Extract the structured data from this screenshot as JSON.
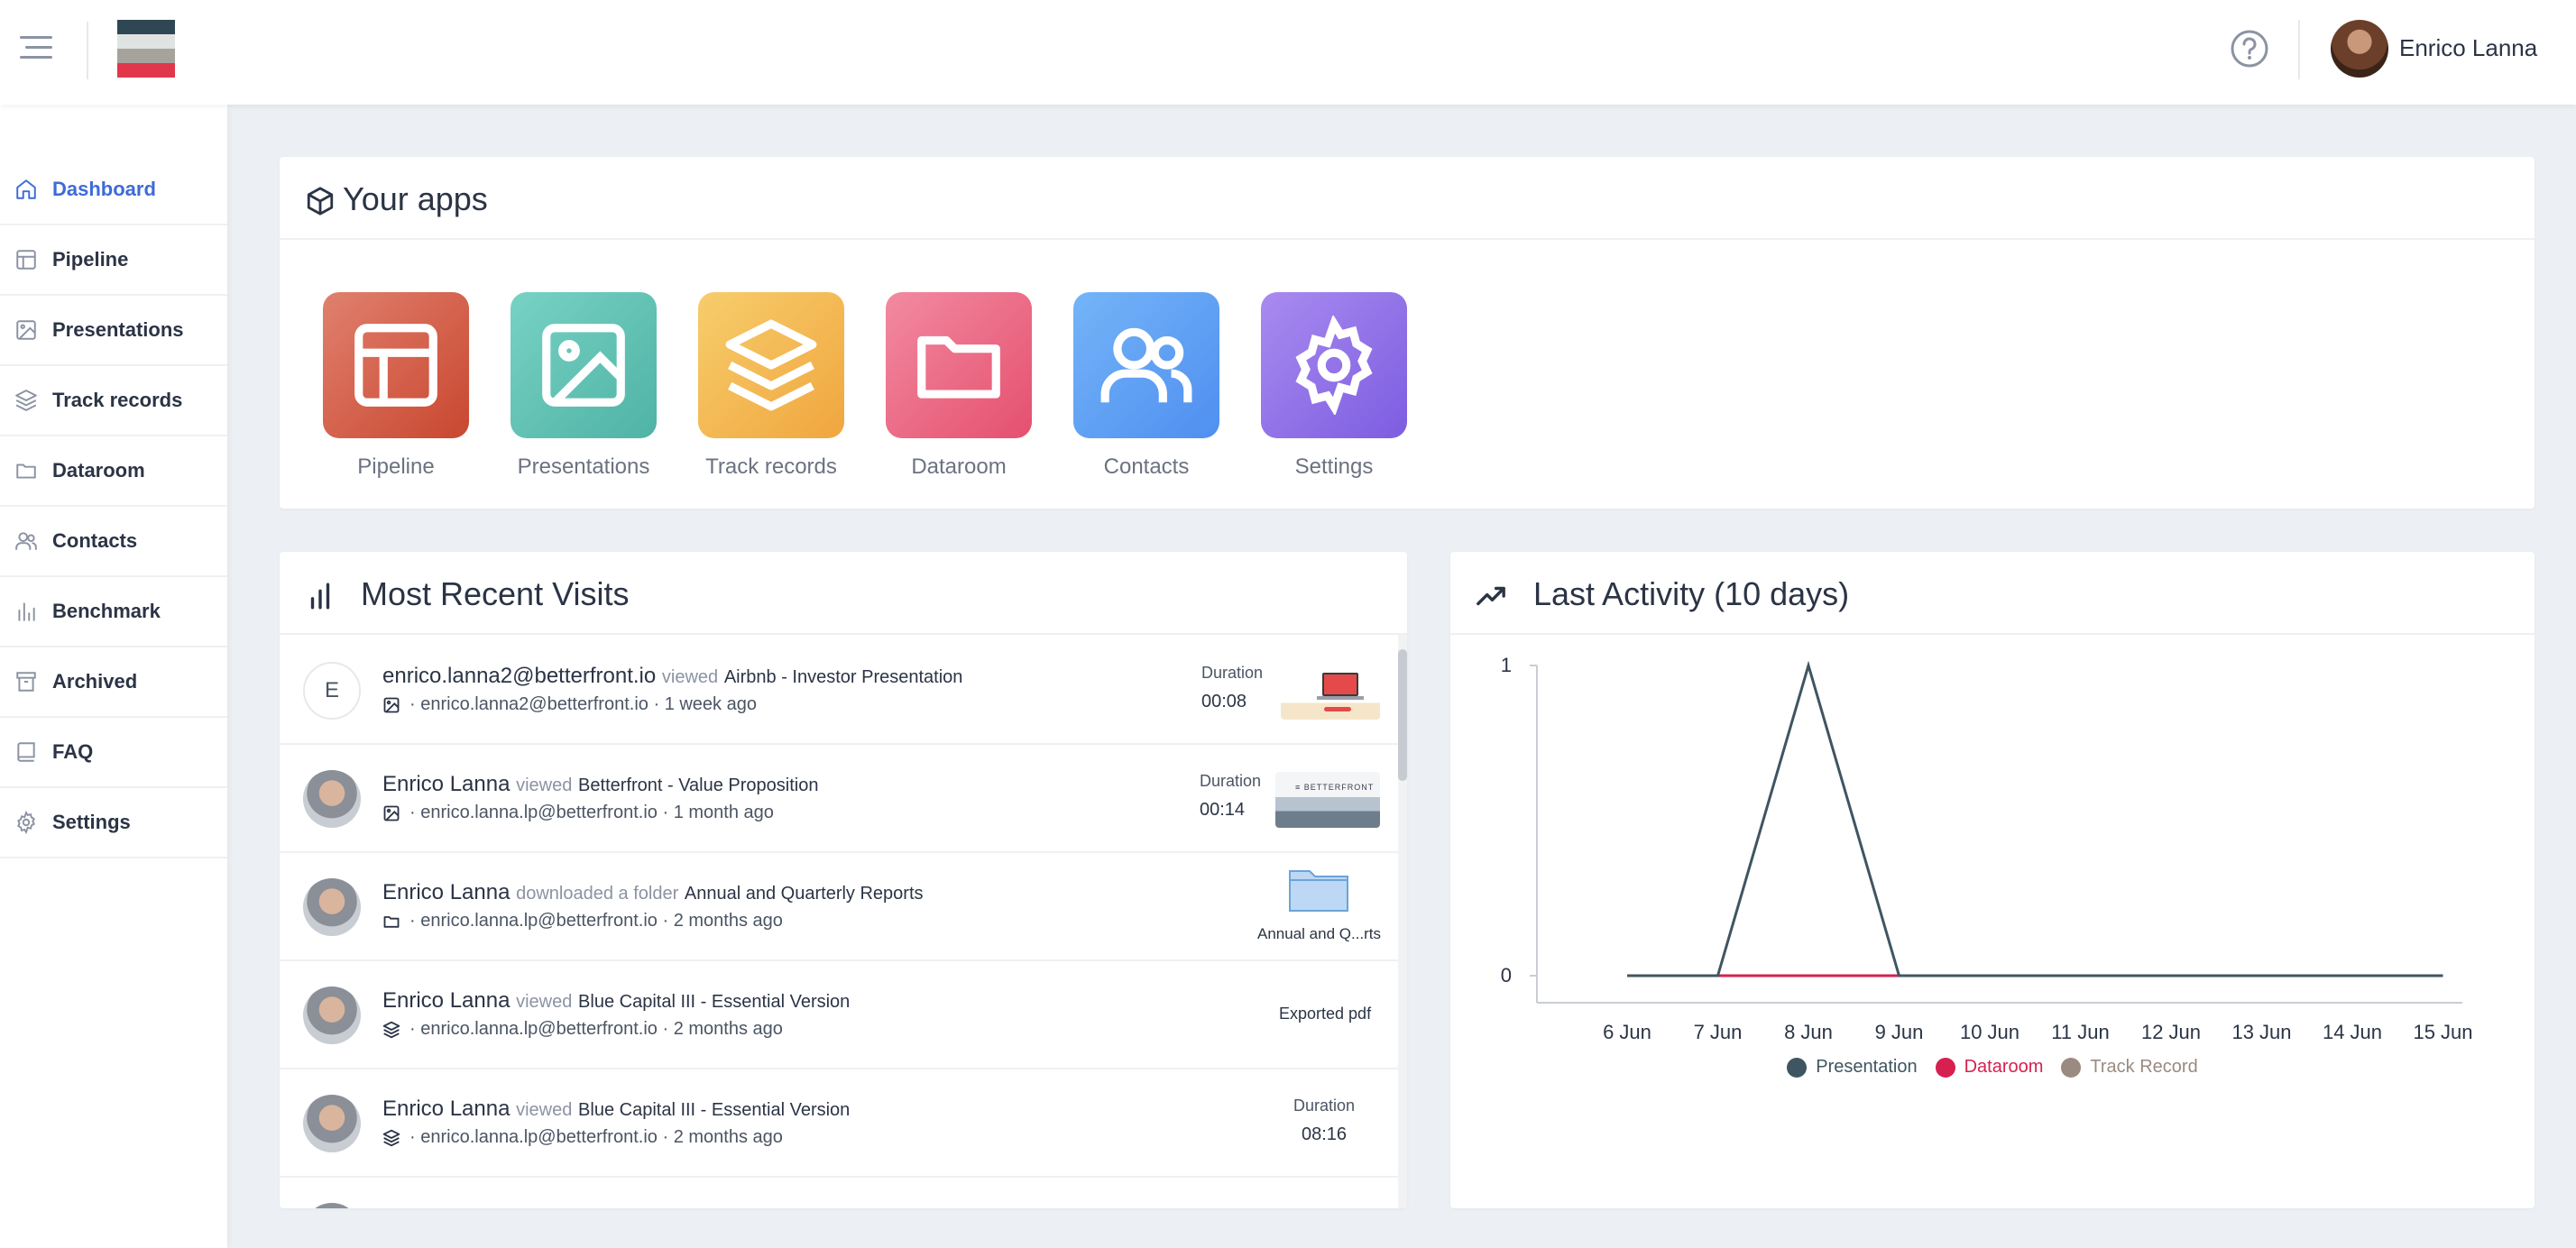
{
  "header": {
    "user_name": "Enrico Lanna"
  },
  "sidebar": {
    "items": [
      {
        "label": "Dashboard",
        "icon": "home-icon",
        "active": true
      },
      {
        "label": "Pipeline",
        "icon": "layout-icon"
      },
      {
        "label": "Presentations",
        "icon": "image-icon"
      },
      {
        "label": "Track records",
        "icon": "layers-icon"
      },
      {
        "label": "Dataroom",
        "icon": "folder-icon"
      },
      {
        "label": "Contacts",
        "icon": "users-icon"
      },
      {
        "label": "Benchmark",
        "icon": "bar-chart-icon"
      },
      {
        "label": "Archived",
        "icon": "archive-icon"
      },
      {
        "label": "FAQ",
        "icon": "book-icon"
      },
      {
        "label": "Settings",
        "icon": "gear-icon"
      }
    ]
  },
  "apps": {
    "title": "Your apps",
    "items": [
      {
        "label": "Pipeline",
        "icon": "layout-icon",
        "color_from": "#e0806e",
        "color_to": "#c9472f"
      },
      {
        "label": "Presentations",
        "icon": "image-icon",
        "color_from": "#77d2c4",
        "color_to": "#4fb3a5"
      },
      {
        "label": "Track records",
        "icon": "layers-icon",
        "color_from": "#f7cd6c",
        "color_to": "#f0a63e"
      },
      {
        "label": "Dataroom",
        "icon": "folder-icon",
        "color_from": "#f28aa0",
        "color_to": "#e5506f"
      },
      {
        "label": "Contacts",
        "icon": "users-icon",
        "color_from": "#74b4f8",
        "color_to": "#4f8ff0"
      },
      {
        "label": "Settings",
        "icon": "gear-icon",
        "color_from": "#a98bf0",
        "color_to": "#7d5de0"
      }
    ]
  },
  "visits": {
    "title": "Most Recent Visits",
    "rows": [
      {
        "avatar_letter": "E",
        "name": "enrico.lanna2@betterfront.io",
        "verb": "viewed",
        "object": "Airbnb - Investor Presentation",
        "email": "enrico.lanna2@betterfront.io",
        "ago": "1 week ago",
        "type_icon": "image-icon",
        "meta_label": "Duration",
        "meta_value": "00:08",
        "thumb": "presentation"
      },
      {
        "avatar_letter": "",
        "name": "Enrico Lanna",
        "verb": "viewed",
        "object": "Betterfront - Value Proposition",
        "email": "enrico.lanna.lp@betterfront.io",
        "ago": "1 month ago",
        "type_icon": "image-icon",
        "meta_label": "Duration",
        "meta_value": "00:14",
        "thumb": "betterfront",
        "thumb_text": "≡ BETTERFRONT"
      },
      {
        "avatar_letter": "",
        "name": "Enrico Lanna",
        "verb": "downloaded a folder",
        "object": "Annual and Quarterly Reports",
        "email": "enrico.lanna.lp@betterfront.io",
        "ago": "2 months ago",
        "type_icon": "folder-icon",
        "meta_label": "Annual and Q...rts",
        "meta_value": "",
        "thumb": "folder"
      },
      {
        "avatar_letter": "",
        "name": "Enrico Lanna",
        "verb": "viewed",
        "object": "Blue Capital III - Essential Version",
        "email": "enrico.lanna.lp@betterfront.io",
        "ago": "2 months ago",
        "type_icon": "layers-icon",
        "meta_label": "Exported pdf",
        "meta_value": "",
        "thumb": ""
      },
      {
        "avatar_letter": "",
        "name": "Enrico Lanna",
        "verb": "viewed",
        "object": "Blue Capital III - Essential Version",
        "email": "enrico.lanna.lp@betterfront.io",
        "ago": "2 months ago",
        "type_icon": "layers-icon",
        "meta_label": "Duration",
        "meta_value": "08:16",
        "thumb": ""
      }
    ]
  },
  "activity": {
    "title": "Last Activity (10 days)"
  },
  "chart_data": {
    "type": "line",
    "categories": [
      "6 Jun",
      "7 Jun",
      "8 Jun",
      "9 Jun",
      "10 Jun",
      "11 Jun",
      "12 Jun",
      "13 Jun",
      "14 Jun",
      "15 Jun"
    ],
    "series": [
      {
        "name": "Presentation",
        "color": "#3f5561",
        "values": [
          0,
          0,
          1,
          0,
          0,
          0,
          0,
          0,
          0,
          0
        ]
      },
      {
        "name": "Dataroom",
        "color": "#d6204f",
        "values": [
          0,
          0,
          0,
          0,
          0,
          0,
          0,
          0,
          0,
          0
        ]
      },
      {
        "name": "Track Record",
        "color": "#9a8a80",
        "values": [
          0,
          0,
          0,
          0,
          0,
          0,
          0,
          0,
          0,
          0
        ]
      }
    ],
    "yticks": [
      0,
      1
    ],
    "ylim": [
      0,
      1
    ],
    "grid": false,
    "legend": "bottom"
  }
}
